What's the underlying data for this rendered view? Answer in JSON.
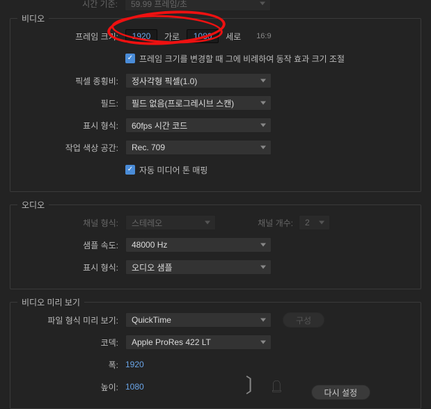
{
  "top": {
    "timebase_label": "시간 기준:",
    "timebase_value": "59.99 프레임/초"
  },
  "video": {
    "title": "비디오",
    "frame_size_label": "프레임 크기:",
    "width": "1920",
    "by": "가로",
    "height": "1080",
    "vert": "세로",
    "ratio": "16:9",
    "scale_checkbox": "프레임 크기를 변경할 때 그에 비례하여 동작 효과 크기 조절",
    "pixel_aspect_label": "픽셀 종횡비:",
    "pixel_aspect_value": "정사각형 픽셀(1.0)",
    "field_label": "필드:",
    "field_value": "필드 없음(프로그레시브 스캔)",
    "display_format_label": "표시 형식:",
    "display_format_value": "60fps 시간 코드",
    "color_space_label": "작업 색상 공간:",
    "color_space_value": "Rec. 709",
    "tone_mapping": "자동 미디어 톤 매핑"
  },
  "audio": {
    "title": "오디오",
    "channel_format_label": "채널 형식:",
    "channel_format_value": "스테레오",
    "channel_count_label": "채널 개수:",
    "channel_count_value": "2",
    "sample_rate_label": "샘플 속도:",
    "sample_rate_value": "48000 Hz",
    "display_format_label": "표시 형식:",
    "display_format_value": "오디오 샘플"
  },
  "preview": {
    "title": "비디오 미리 보기",
    "file_format_label": "파일 형식 미리 보기:",
    "file_format_value": "QuickTime",
    "config_btn": "구성",
    "codec_label": "코덱:",
    "codec_value": "Apple ProRes 422 LT",
    "width_label": "폭:",
    "width_value": "1920",
    "height_label": "높이:",
    "height_value": "1080",
    "reset_btn": "다시 설정"
  }
}
